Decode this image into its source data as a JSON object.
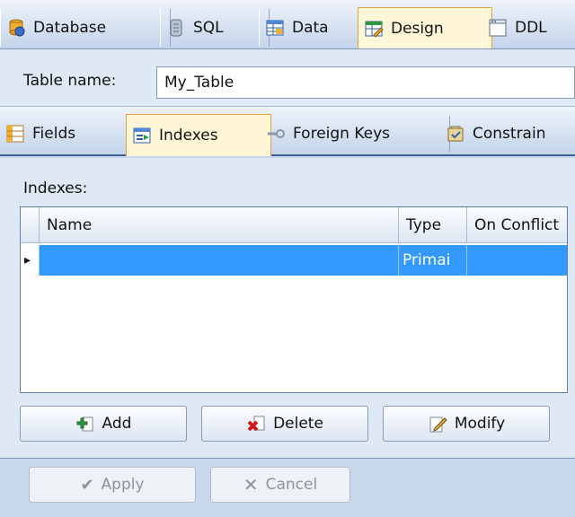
{
  "top_tabs": [
    {
      "label": "Database",
      "icon": "database-icon"
    },
    {
      "label": "SQL",
      "icon": "sql-scroll-icon"
    },
    {
      "label": "Data",
      "icon": "data-grid-icon"
    },
    {
      "label": "Design",
      "icon": "design-table-icon",
      "active": true
    },
    {
      "label": "DDL",
      "icon": "ddl-window-icon"
    }
  ],
  "table_name": {
    "label": "Table name:",
    "value": "My_Table"
  },
  "sub_tabs": [
    {
      "label": "Fields",
      "icon": "fields-icon"
    },
    {
      "label": "Indexes",
      "icon": "indexes-icon",
      "active": true
    },
    {
      "label": "Foreign Keys",
      "icon": "key-icon"
    },
    {
      "label": "Constrain",
      "icon": "constraints-icon"
    }
  ],
  "indexes": {
    "label": "Indexes:",
    "columns": [
      "Name",
      "Type",
      "On Conflict"
    ],
    "rows": [
      {
        "indicator": "▸",
        "name": "",
        "type": "Primai",
        "on_conflict": ""
      }
    ]
  },
  "buttons": {
    "add": "Add",
    "delete": "Delete",
    "modify": "Modify"
  },
  "footer": {
    "apply": "Apply",
    "cancel": "Cancel"
  },
  "colors": {
    "selection": "#3399ff",
    "active_tab": "#fff6d8",
    "panel": "#dfe8f5"
  }
}
